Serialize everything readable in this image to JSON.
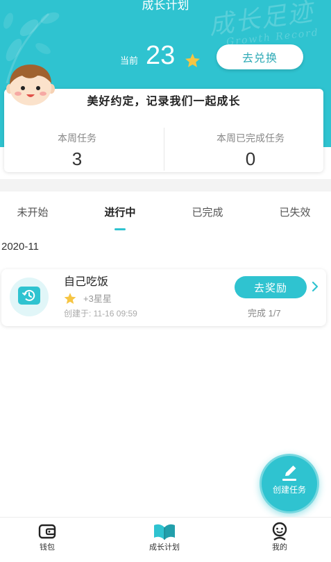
{
  "header": {
    "title": "成长计划",
    "watermark_cn": "成长足迹",
    "watermark_en": "Growth Record",
    "current_label": "当前",
    "current_stars": "23",
    "star_icon": "star-icon",
    "exchange_button": "去兑换"
  },
  "summary": {
    "slogan": "美好约定，记录我们一起成长",
    "weekly_tasks_label": "本周任务",
    "weekly_tasks_value": "3",
    "weekly_done_label": "本周已完成任务",
    "weekly_done_value": "0"
  },
  "tabs": [
    {
      "label": "未开始",
      "active": false
    },
    {
      "label": "进行中",
      "active": true
    },
    {
      "label": "已完成",
      "active": false
    },
    {
      "label": "已失效",
      "active": false
    }
  ],
  "month": "2020-11",
  "tasks": [
    {
      "icon": "clock-icon",
      "title": "自己吃饭",
      "reward_icon": "star-icon",
      "reward": "+3星星",
      "created": "创建于: 11-16 09:59",
      "action": "去奖励",
      "progress": "完成 1/7"
    }
  ],
  "fab": {
    "icon": "pencil-icon",
    "label": "创建任务"
  },
  "bottom_nav": [
    {
      "icon": "wallet-icon",
      "label": "钱包",
      "active": false
    },
    {
      "icon": "book-icon",
      "label": "成长计划",
      "active": true
    },
    {
      "icon": "face-icon",
      "label": "我的",
      "active": false
    }
  ],
  "colors": {
    "accent": "#2fc3d0",
    "star": "#f6c543",
    "text": "#222222",
    "muted": "#999999",
    "separator": "#f3f3f3"
  }
}
